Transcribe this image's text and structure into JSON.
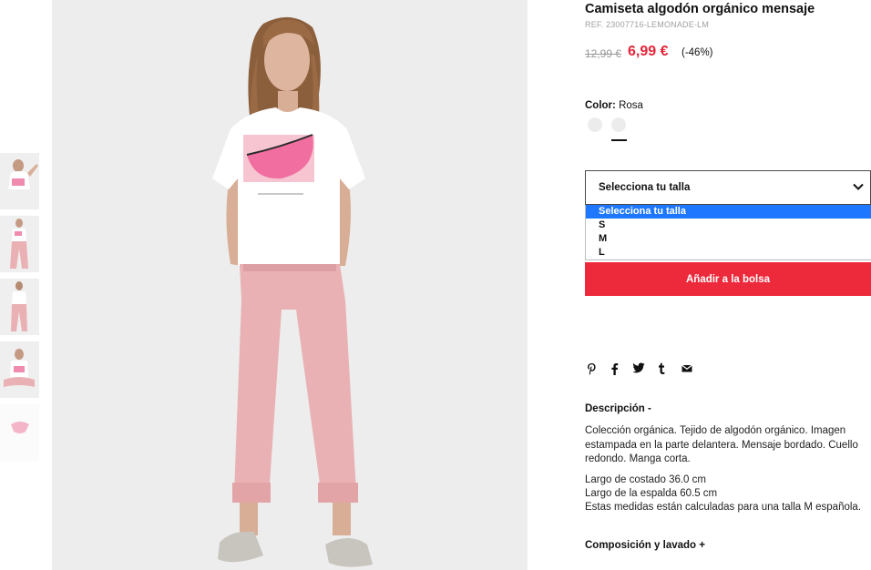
{
  "product": {
    "title": "Camiseta algodón orgánico mensaje",
    "ref": "REF. 23007716-LEMONADE-LM",
    "old_price": "12,99 €",
    "new_price": "6,99 €",
    "discount": "(-46%)"
  },
  "color": {
    "label": "Color:",
    "value": "Rosa",
    "swatches": [
      "swatch-1",
      "swatch-2"
    ]
  },
  "size_select": {
    "label": "Selecciona tu talla",
    "options": [
      "Selecciona tu talla",
      "S",
      "M",
      "L"
    ],
    "selected_index": 0
  },
  "add_to_bag": "Añadir a la bolsa",
  "social": {
    "icons": [
      "pinterest-icon",
      "facebook-icon",
      "twitter-icon",
      "tumblr-icon",
      "email-icon"
    ],
    "glyphs": [
      "℗",
      "f",
      "✓",
      "t",
      "✉"
    ]
  },
  "description": {
    "title": "Descripción -",
    "text": "Colección orgánica. Tejido de algodón orgánico. Imagen estampada en la parte delantera. Mensaje bordado. Cuello redondo. Manga corta.",
    "measurements": [
      "Largo de costado 36.0 cm",
      "Largo de la espalda 60.5 cm",
      "Estas medidas están calculadas para una talla M española."
    ]
  },
  "composition": {
    "title": "Composición y lavado +"
  },
  "colors": {
    "sale_red": "#e6253a",
    "button_red": "#ed2a3c",
    "select_highlight": "#1e78ff",
    "tee_white": "#ffffff",
    "pants_pink": "#e9b1b4",
    "photo_bg": "#ededed"
  }
}
